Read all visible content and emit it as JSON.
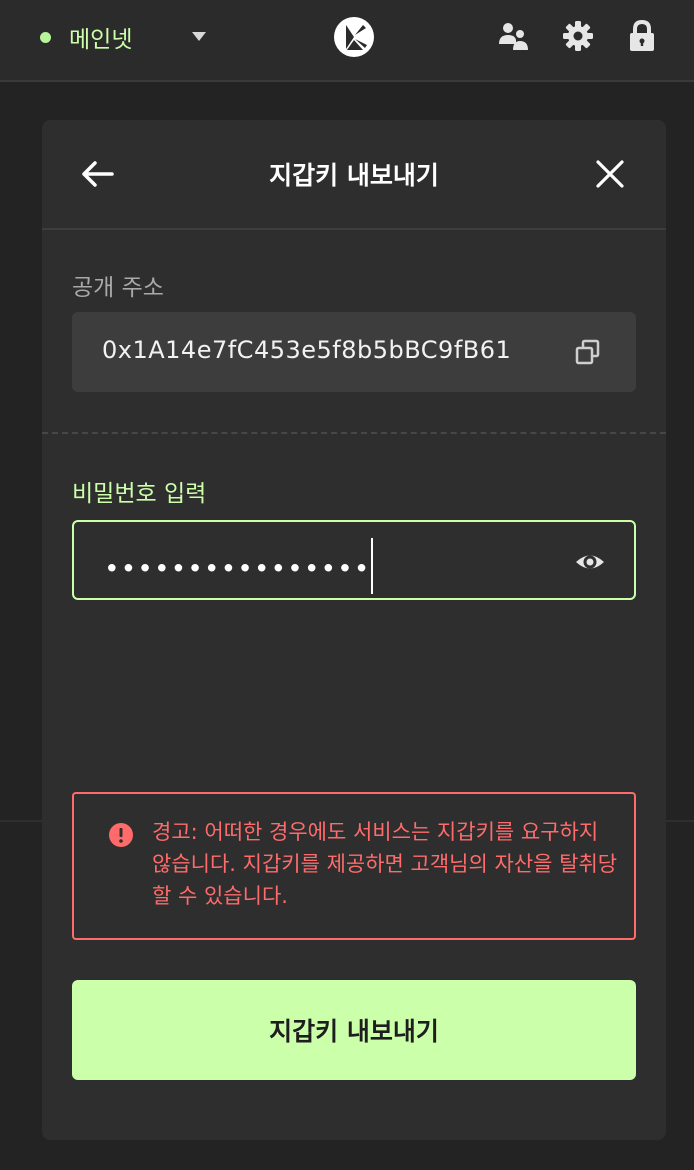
{
  "colors": {
    "accent": "#ccffaa",
    "warning": "#ff6b6b",
    "net_dot": "#b8f59a"
  },
  "topbar": {
    "network_label": "메인넷",
    "icons": [
      "people-icon",
      "gear-icon",
      "lock-icon"
    ]
  },
  "panel": {
    "title": "지갑키 내보내기",
    "address_label": "공개 주소",
    "address_value": "0x1A14e7fC453e5f8b5bBC9fB61",
    "password_label": "비밀번호 입력",
    "password_masked": "••••••••••••••••",
    "warning_text": "경고: 어떠한 경우에도 서비스는 지갑키를 요구하지 않습니다. 지갑키를 제공하면 고객님의 자산을 탈취당할 수 있습니다.",
    "export_button": "지갑키 내보내기"
  }
}
